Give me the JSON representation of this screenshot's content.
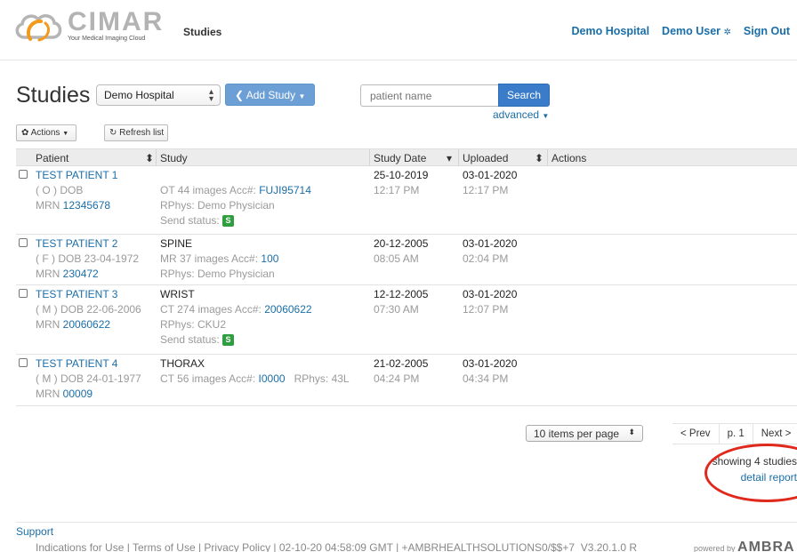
{
  "brand": {
    "name": "CIMAR",
    "tagline": "Your Medical Imaging Cloud"
  },
  "nav": {
    "studies": "Studies",
    "hospital": "Demo Hospital",
    "user": "Demo User",
    "signout": "Sign Out"
  },
  "page": {
    "title": "Studies",
    "hospital_select": "Demo Hospital",
    "add_study": "Add Study",
    "search_placeholder": "patient name",
    "search_button": "Search",
    "advanced": "advanced",
    "actions_button": "Actions",
    "refresh_button": "Refresh list"
  },
  "table": {
    "headers": {
      "patient": "Patient",
      "study": "Study",
      "study_date": "Study Date",
      "uploaded": "Uploaded",
      "actions": "Actions"
    },
    "rows": [
      {
        "name": "TEST PATIENT 1",
        "demo": "( O ) DOB",
        "mrn_label": "MRN",
        "mrn": "12345678",
        "study_name": "",
        "modality_line": "OT  44 images  Acc#:",
        "acc": "FUJI95714",
        "rphys": "RPhys: Demo Physician",
        "send_status": "Send status:",
        "badge": "S",
        "date": "25-10-2019",
        "time": "12:17 PM",
        "up_date": "03-01-2020",
        "up_time": "12:17 PM"
      },
      {
        "name": "TEST PATIENT 2",
        "demo": "( F ) DOB 23-04-1972",
        "mrn_label": "MRN",
        "mrn": "230472",
        "study_name": "SPINE",
        "modality_line": "MR  37 images  Acc#:",
        "acc": "100",
        "rphys": "RPhys: Demo Physician",
        "date": "20-12-2005",
        "time": "08:05 AM",
        "up_date": "03-01-2020",
        "up_time": "02:04 PM"
      },
      {
        "name": "TEST PATIENT 3",
        "demo": "( M ) DOB 22-06-2006",
        "mrn_label": "MRN",
        "mrn": "20060622",
        "study_name": "WRIST",
        "modality_line": "CT  274 images  Acc#:",
        "acc": "20060622",
        "rphys": "RPhys: CKU2",
        "send_status": "Send status:",
        "badge": "S",
        "date": "12-12-2005",
        "time": "07:30 AM",
        "up_date": "03-01-2020",
        "up_time": "12:07 PM"
      },
      {
        "name": "TEST PATIENT 4",
        "demo": "( M ) DOB 24-01-1977",
        "mrn_label": "MRN",
        "mrn": "00009",
        "study_name": "THORAX",
        "modality_line": "CT  56 images  Acc#:",
        "acc": "I0000",
        "rphys": "RPhys: 43L",
        "date": "21-02-2005",
        "time": "04:24 PM",
        "up_date": "03-01-2020",
        "up_time": "04:34 PM"
      }
    ]
  },
  "pagination": {
    "items_per_page": "10 items per page",
    "prev": "< Prev",
    "page": "p. 1",
    "next": "Next >",
    "showing": "showing 4 studies",
    "detail_report": "detail report"
  },
  "footer": {
    "support": "Support",
    "links": "Indications for Use  |  Terms of Use  |  Privacy Policy  |  02-10-20 04:58:09 GMT  |  +AMBRHEALTHSOLUTIONS0/$$+7_V3.20.1.0 R",
    "powered_by": "powered by",
    "powered_brand": "AMBRA"
  },
  "colors": {
    "link": "#1a6ea8",
    "add_button": "#6b9fd6",
    "search_button": "#3a7cc9",
    "badge_green": "#2e9e3e",
    "annotation_red": "#e0291d"
  }
}
